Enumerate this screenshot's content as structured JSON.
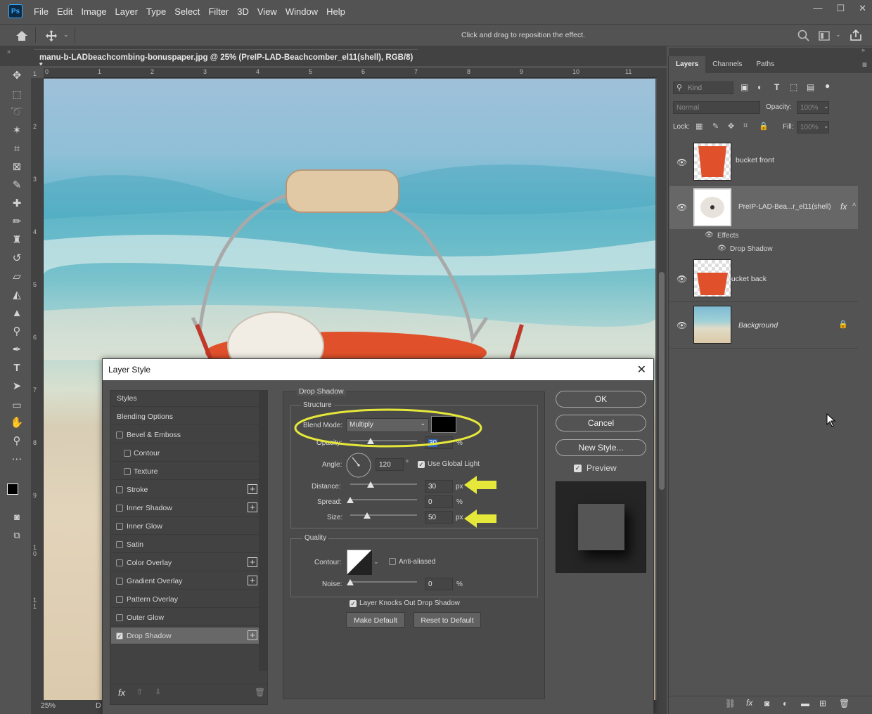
{
  "app": {
    "logo": "Ps"
  },
  "menu": [
    "File",
    "Edit",
    "Image",
    "Layer",
    "Type",
    "Select",
    "Filter",
    "3D",
    "View",
    "Window",
    "Help"
  ],
  "window_controls": [
    "—",
    "☐",
    "✕"
  ],
  "options_bar": {
    "hint": "Click and drag to reposition the effect."
  },
  "document_tab": {
    "title": "manu-b-LADbeachcombing-bonuspaper.jpg @ 25% (PreIP-LAD-Beachcomber_el11(shell), RGB/8) *",
    "close": "×"
  },
  "ruler": {
    "top": [
      "0",
      "1",
      "2",
      "3",
      "4",
      "5",
      "6",
      "7",
      "8",
      "9",
      "10",
      "11"
    ],
    "left": [
      "1",
      "2",
      "3",
      "4",
      "5",
      "6",
      "7",
      "8",
      "9",
      "1\n0",
      "1\n1"
    ]
  },
  "status": {
    "zoom": "25%",
    "extra": "D"
  },
  "layers_panel": {
    "tabs": [
      "Layers",
      "Channels",
      "Paths"
    ],
    "search_placeholder": "Kind",
    "blend_mode": "Normal",
    "opacity_label": "Opacity:",
    "opacity_value": "100%",
    "lock_label": "Lock:",
    "fill_label": "Fill:",
    "fill_value": "100%",
    "layers": [
      {
        "name": "bucket front"
      },
      {
        "name": "PreIP-LAD-Bea...r_el11(shell)",
        "fx": "fx",
        "effects_label": "Effects",
        "effect": "Drop Shadow"
      },
      {
        "name": "bucket back"
      },
      {
        "name": "Background"
      }
    ]
  },
  "dialog": {
    "title": "Layer Style",
    "close": "✕",
    "styles": [
      {
        "label": "Styles",
        "has_cb": false,
        "plus": false
      },
      {
        "label": "Blending Options",
        "has_cb": false,
        "plus": false
      },
      {
        "label": "Bevel & Emboss",
        "has_cb": true,
        "plus": false
      },
      {
        "label": "Contour",
        "has_cb": true,
        "plus": false,
        "indent": true
      },
      {
        "label": "Texture",
        "has_cb": true,
        "plus": false,
        "indent": true
      },
      {
        "label": "Stroke",
        "has_cb": true,
        "plus": true
      },
      {
        "label": "Inner Shadow",
        "has_cb": true,
        "plus": true
      },
      {
        "label": "Inner Glow",
        "has_cb": true,
        "plus": false
      },
      {
        "label": "Satin",
        "has_cb": true,
        "plus": false
      },
      {
        "label": "Color Overlay",
        "has_cb": true,
        "plus": true
      },
      {
        "label": "Gradient Overlay",
        "has_cb": true,
        "plus": true
      },
      {
        "label": "Pattern Overlay",
        "has_cb": true,
        "plus": false
      },
      {
        "label": "Outer Glow",
        "has_cb": true,
        "plus": false
      },
      {
        "label": "Drop Shadow",
        "has_cb": true,
        "plus": true,
        "checked": true,
        "active": true
      }
    ],
    "section_title": "Drop Shadow",
    "structure_title": "Structure",
    "blend_mode_label": "Blend Mode:",
    "blend_mode_value": "Multiply",
    "opacity_label": "Opacity:",
    "opacity_value": "30",
    "angle_label": "Angle:",
    "angle_value": "120",
    "angle_unit": "°",
    "global_light_label": "Use Global Light",
    "distance_label": "Distance:",
    "distance_value": "30",
    "spread_label": "Spread:",
    "spread_value": "0",
    "size_label": "Size:",
    "size_value": "50",
    "unit_px": "px",
    "unit_pct": "%",
    "quality_title": "Quality",
    "contour_label": "Contour:",
    "anti_aliased_label": "Anti-aliased",
    "noise_label": "Noise:",
    "noise_value": "0",
    "knockout_label": "Layer Knocks Out Drop Shadow",
    "make_default": "Make Default",
    "reset_default": "Reset to Default",
    "ok": "OK",
    "cancel": "Cancel",
    "new_style": "New Style...",
    "preview_label": "Preview",
    "footer_fx": "fx",
    "sliders": {
      "opacity": 0.3,
      "distance": 0.3,
      "spread": 0.0,
      "size": 0.25,
      "noise": 0.0
    },
    "colors": {
      "shadow": "#000000",
      "highlight": "#e5e83a"
    }
  }
}
